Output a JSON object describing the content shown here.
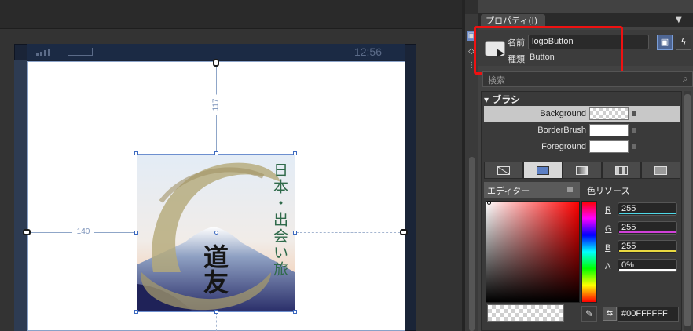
{
  "design": {
    "status_time": "12:56",
    "dimension_top": "117",
    "dimension_left": "140",
    "logo": {
      "title_text": "日本・出会い旅",
      "brush_text": "道友"
    }
  },
  "panel": {
    "tab_title": "プロパティ(I)",
    "name_label": "名前",
    "name_value": "logoButton",
    "type_label": "種類",
    "type_value": "Button",
    "search_placeholder": "検索",
    "category_title": "ブラシ",
    "properties": [
      {
        "label": "Background",
        "swatch": "transparent",
        "selected": true
      },
      {
        "label": "BorderBrush",
        "swatch": "#FFFFFF",
        "selected": false
      },
      {
        "label": "Foreground",
        "swatch": "#FFFFFF",
        "selected": false
      }
    ],
    "editor_tab": "エディター",
    "resource_tab": "色リソース",
    "channels": [
      {
        "label": "R",
        "value": "255",
        "bar_color": "#4fd8e8"
      },
      {
        "label": "G",
        "value": "255",
        "bar_color": "#d040d8"
      },
      {
        "label": "B",
        "value": "255",
        "bar_color": "#e8d840"
      },
      {
        "label": "A",
        "value": "0%",
        "bar_color": "#ffffff"
      }
    ],
    "hex_value": "#00FFFFFF"
  },
  "colors": {
    "highlight": "#EE1111",
    "selection": "#6D8FCF"
  }
}
